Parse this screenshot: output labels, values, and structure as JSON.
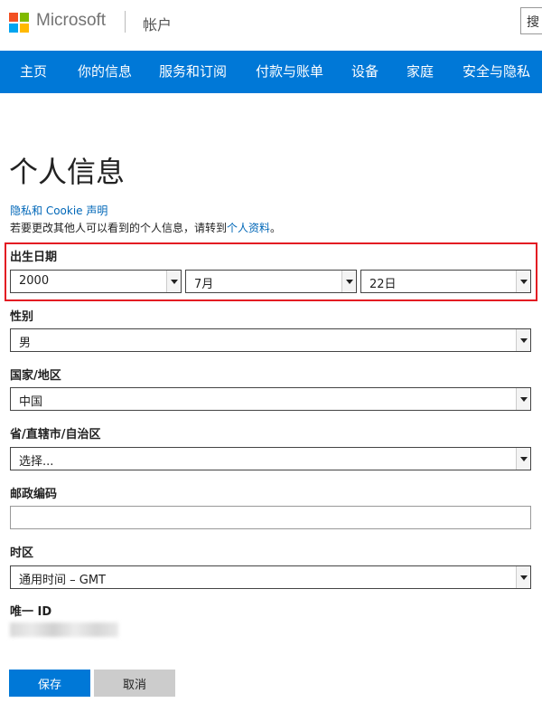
{
  "header": {
    "brand": "Microsoft",
    "section_title": "帐户",
    "search_label": "搜"
  },
  "colors": {
    "nav_bg": "#0078d7",
    "link": "#0067b8",
    "highlight": "#e31b23",
    "logo": [
      "#f25022",
      "#7fba00",
      "#00a4ef",
      "#ffb900"
    ]
  },
  "nav": {
    "items": [
      {
        "label": "主页"
      },
      {
        "label": "你的信息"
      },
      {
        "label": "服务和订阅"
      },
      {
        "label": "付款与账单"
      },
      {
        "label": "设备"
      },
      {
        "label": "家庭"
      },
      {
        "label": "安全与隐私"
      }
    ]
  },
  "page": {
    "title": "个人信息",
    "privacy_link": "隐私和 Cookie 声明",
    "info_text": "若要更改其他人可以看到的个人信息，请转到",
    "info_link": "个人资料",
    "info_suffix": "。"
  },
  "form": {
    "birthdate": {
      "label": "出生日期",
      "year": "2000",
      "month": "7月",
      "day": "22日"
    },
    "gender": {
      "label": "性别",
      "value": "男"
    },
    "country": {
      "label": "国家/地区",
      "value": "中国"
    },
    "province": {
      "label": "省/直辖市/自治区",
      "value": "选择..."
    },
    "postal": {
      "label": "邮政编码",
      "value": ""
    },
    "timezone": {
      "label": "时区",
      "value": "通用时间 – GMT"
    },
    "unique_id": {
      "label": "唯一 ID"
    }
  },
  "actions": {
    "save": "保存",
    "cancel": "取消"
  }
}
